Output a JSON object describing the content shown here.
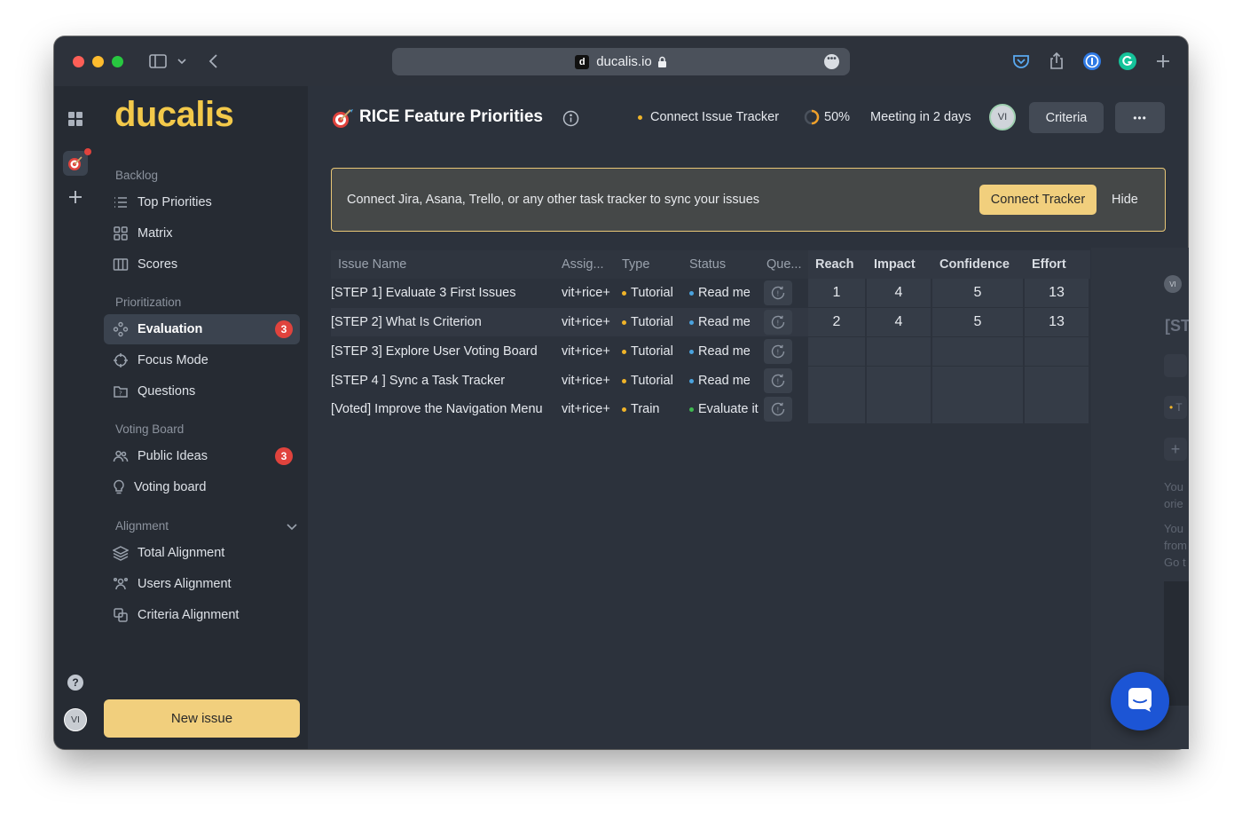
{
  "browser": {
    "url": "ducalis.io",
    "favicon": "d"
  },
  "rail": {
    "help": "?",
    "avatar": "VI"
  },
  "sidebar": {
    "logo": "ducalis",
    "sections": {
      "backlog": "Backlog",
      "prioritization": "Prioritization",
      "voting": "Voting Board",
      "alignment": "Alignment"
    },
    "items": {
      "top_priorities": "Top Priorities",
      "matrix": "Matrix",
      "scores": "Scores",
      "evaluation": "Evaluation",
      "evaluation_badge": "3",
      "focus_mode": "Focus Mode",
      "questions": "Questions",
      "public_ideas": "Public Ideas",
      "public_ideas_badge": "3",
      "voting_board": "Voting board",
      "total_alignment": "Total Alignment",
      "users_alignment": "Users Alignment",
      "criteria_alignment": "Criteria Alignment"
    },
    "new_issue": "New issue"
  },
  "header": {
    "title": "RICE Feature Priorities",
    "connect": "Connect Issue Tracker",
    "progress": "50%",
    "progress_value": 0.5,
    "meeting": "Meeting in 2 days",
    "avatar": "VI",
    "criteria": "Criteria",
    "more": "•••"
  },
  "banner": {
    "text": "Connect Jira, Asana, Trello, or any other task tracker to sync your issues",
    "button": "Connect Tracker",
    "hide": "Hide"
  },
  "table": {
    "headers": {
      "name": "Issue Name",
      "assignee": "Assig...",
      "type": "Type",
      "status": "Status",
      "questions": "Que...",
      "reach": "Reach",
      "impact": "Impact",
      "confidence": "Confidence",
      "effort": "Effort"
    },
    "rows": [
      {
        "name": "[STEP 1] Evaluate 3 First Issues",
        "assignee": "vit+rice+",
        "type": "Tutorial",
        "status": "Read me",
        "reach": "1",
        "impact": "4",
        "confidence": "5",
        "effort": "13"
      },
      {
        "name": "[STEP 2] What Is Criterion",
        "assignee": "vit+rice+",
        "type": "Tutorial",
        "status": "Read me",
        "reach": "2",
        "impact": "4",
        "confidence": "5",
        "effort": "13"
      },
      {
        "name": "[STEP 3] Explore User Voting Board",
        "assignee": "vit+rice+",
        "type": "Tutorial",
        "status": "Read me",
        "reach": "",
        "impact": "",
        "confidence": "",
        "effort": ""
      },
      {
        "name": "[STEP 4 ] Sync a Task Tracker",
        "assignee": "vit+rice+",
        "type": "Tutorial",
        "status": "Read me",
        "reach": "",
        "impact": "",
        "confidence": "",
        "effort": ""
      },
      {
        "name": "[Voted] Improve the Navigation Menu",
        "assignee": "vit+rice+",
        "type": "Train",
        "status": "Evaluate it",
        "reach": "",
        "impact": "",
        "confidence": "",
        "effort": ""
      }
    ]
  },
  "right_panel": {
    "avatar": "VI",
    "title_fragment": "[ST",
    "tag_fragment": "T",
    "text_1a": "You",
    "text_1b": "orie",
    "text_2a": "You",
    "text_2b": "from",
    "text_2c": "Go t"
  },
  "colors": {
    "accent": "#f1cf7d",
    "logo": "#f3c94a",
    "badge": "#e0433d",
    "dot_tutorial": "#f0b429",
    "dot_train": "#f0b429",
    "dot_read": "#4aa3df",
    "dot_evaluate": "#3fb950",
    "chat": "#1c55d5"
  }
}
